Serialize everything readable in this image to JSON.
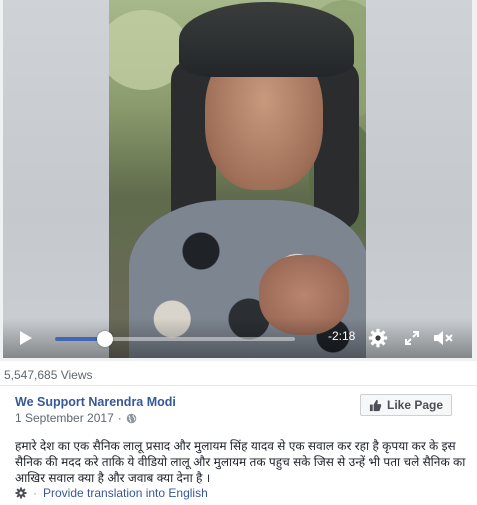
{
  "video": {
    "time_remaining": "-2:18",
    "progress": 0.21,
    "views": "5,547,685 Views"
  },
  "post": {
    "page_name": "We Support Narendra Modi",
    "date": "1 September 2017",
    "date_separator": "·",
    "like_button_label": "Like Page",
    "body": "हमारे देश का एक सैनिक लालू प्रसाद और मुलायम सिंह यादव से एक सवाल कर रहा है कृपया कर के इस सैनिक की मदद करे ताकि ये वीडियो लालू और मुलायम तक पहुच सके जिस से उन्हें भी पता चले सैनिक का आखिर सवाल क्या है और जवाब क्या देना है ।",
    "translate_separator": "·",
    "translate_label": "Provide translation into English"
  },
  "colors": {
    "progress_fill": "#4267b2",
    "page_link": "#365899"
  },
  "icons": {
    "play": "play-icon",
    "settings": "gear-icon",
    "fullscreen": "fullscreen-icon",
    "mute": "mute-icon",
    "globe": "globe-icon",
    "like": "thumbs-up-icon",
    "translate": "gear-icon"
  }
}
